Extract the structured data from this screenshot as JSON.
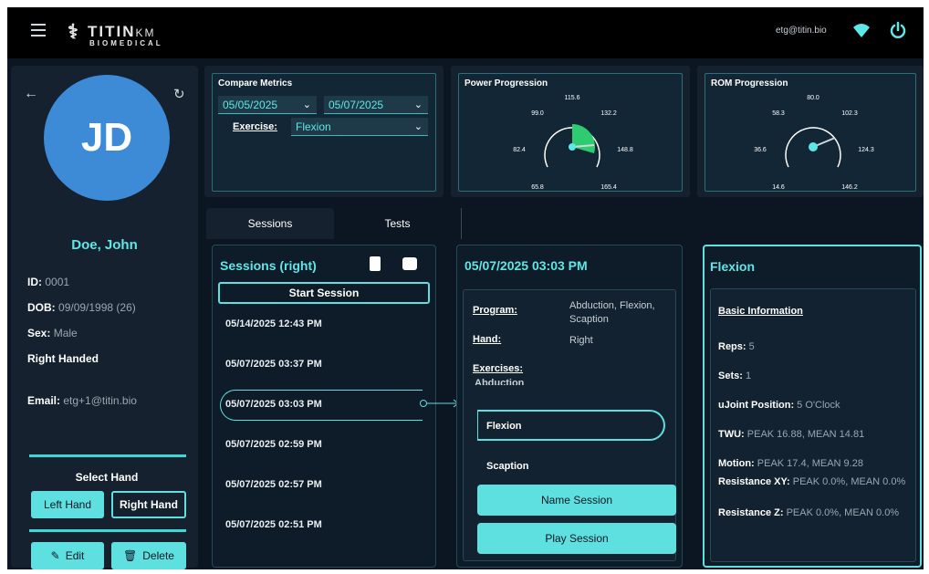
{
  "header": {
    "logo_text": "TITIN",
    "logo_km": "KM",
    "logo_sub": "BIOMEDICAL",
    "user_email": "etg@titin.bio",
    "icons": [
      "menu-icon",
      "wifi-icon",
      "power-icon"
    ]
  },
  "patient": {
    "initials": "JD",
    "name": "Doe, John",
    "id_label": "ID:",
    "id_value": "0001",
    "dob_label": "DOB:",
    "dob_value": "09/09/1998 (26)",
    "sex_label": "Sex:",
    "sex_value": "Male",
    "handed": "Right Handed",
    "email_label": "Email:",
    "email_value": "etg+1@titin.bio",
    "select_hand_label": "Select Hand",
    "left_hand": "Left Hand",
    "right_hand": "Right Hand",
    "edit": "Edit",
    "delete": "Delete"
  },
  "compare": {
    "title": "Compare Metrics",
    "date_from": "05/05/2025",
    "date_to": "05/07/2025",
    "exercise_label": "Exercise:",
    "exercise_value": "Flexion"
  },
  "power": {
    "title": "Power Progression",
    "ticks": [
      "115.6",
      "99.0",
      "132.2",
      "82.4",
      "148.8",
      "65.8",
      "165.4"
    ],
    "value": 138
  },
  "rom": {
    "title": "ROM Progression",
    "ticks": [
      "80.0",
      "58.3",
      "102.3",
      "36.6",
      "124.3",
      "14.6",
      "146.2"
    ],
    "value": 112
  },
  "tabs": [
    "Sessions",
    "Tests"
  ],
  "sessions": {
    "title": "Sessions (right)",
    "start": "Start Session",
    "items": [
      "05/14/2025 12:43 PM",
      "05/07/2025 03:37 PM",
      "05/07/2025 03:03 PM",
      "05/07/2025 02:59 PM",
      "05/07/2025 02:57 PM",
      "05/07/2025 02:51 PM"
    ]
  },
  "detail": {
    "title": "05/07/2025 03:03 PM",
    "program_label": "Program:",
    "program_value": "Abduction, Flexion, Scaption",
    "hand_label": "Hand:",
    "hand_value": "Right",
    "exercises_label": "Exercises:",
    "exercises": [
      "Abduction",
      "Flexion",
      "Scaption"
    ],
    "name_session": "Name Session",
    "play_session": "Play Session"
  },
  "exercise": {
    "title": "Flexion",
    "basic_info": "Basic Information",
    "reps_label": "Reps:",
    "reps_value": "5",
    "sets_label": "Sets:",
    "sets_value": "1",
    "joint_label": "uJoint Position:",
    "joint_value": "5 O'Clock",
    "twu_label": "TWU:",
    "twu_value": "PEAK 16.88, MEAN 14.81",
    "motion_label": "Motion:",
    "motion_value": "PEAK 17.4, MEAN 9.28",
    "resxy_label": "Resistance XY:",
    "resxy_value": "PEAK 0.0%, MEAN 0.0%",
    "resz_label": "Resistance Z:",
    "resz_value": "PEAK 0.0%, MEAN 0.0%"
  },
  "colors": {
    "accent": "#5ee0e0",
    "background": "#0b1622",
    "avatar": "#3d8ad6",
    "gauge_fill": "#2ecc71"
  }
}
